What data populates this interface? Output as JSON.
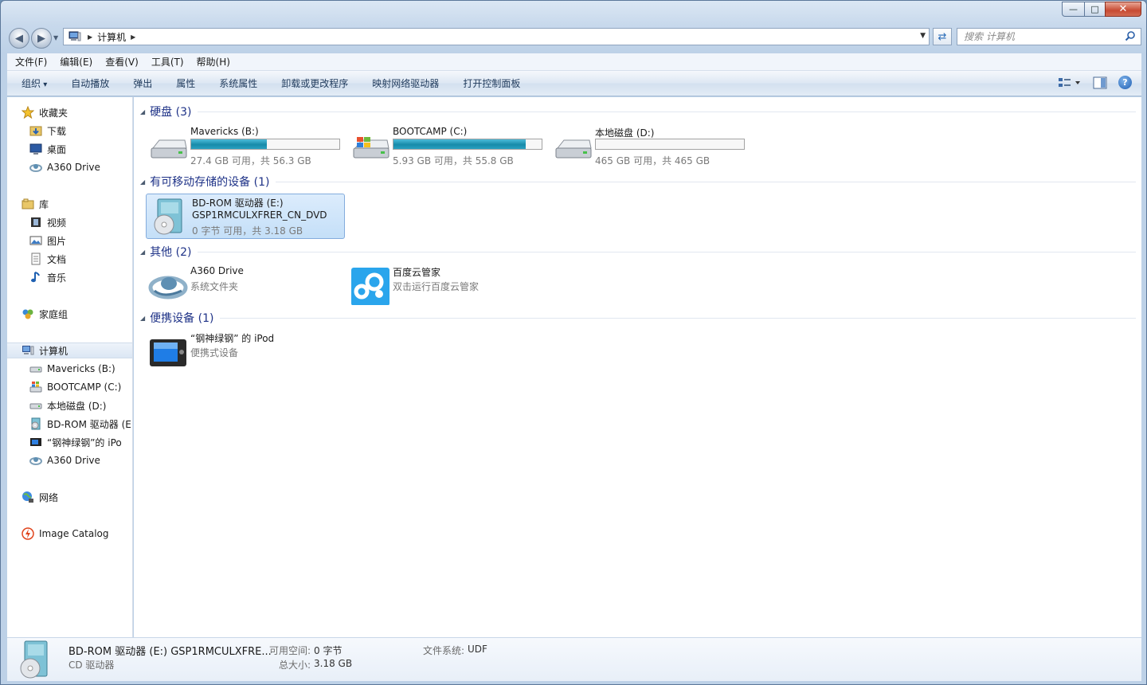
{
  "window": {
    "caption_min": "—",
    "caption_max": "□",
    "caption_close": "✕"
  },
  "address": {
    "crumb": "计算机",
    "search_placeholder": "搜索 计算机"
  },
  "menu": [
    "文件(F)",
    "编辑(E)",
    "查看(V)",
    "工具(T)",
    "帮助(H)"
  ],
  "commands": [
    "组织",
    "自动播放",
    "弹出",
    "属性",
    "系统属性",
    "卸载或更改程序",
    "映射网络驱动器",
    "打开控制面板"
  ],
  "nav": {
    "favorites": "收藏夹",
    "downloads": "下载",
    "desktop": "桌面",
    "a360_fav": "A360 Drive",
    "libraries": "库",
    "videos": "视频",
    "pictures": "图片",
    "documents": "文档",
    "music": "音乐",
    "homegroup": "家庭组",
    "computer": "计算机",
    "mavericks": "Mavericks (B:)",
    "bootcamp": "BOOTCAMP (C:)",
    "local_d": "本地磁盘 (D:)",
    "bdrom": "BD-ROM 驱动器 (E",
    "ipod": "“钢神绿钢”的 iPo",
    "a360_comp": "A360 Drive",
    "network": "网络",
    "image_catalog": "Image Catalog"
  },
  "groups": {
    "hdd": "硬盘 (3)",
    "removable": "有可移动存储的设备 (1)",
    "other": "其他 (2)",
    "portable": "便携设备 (1)"
  },
  "drives": [
    {
      "name": "Mavericks (B:)",
      "info": "27.4 GB 可用，共 56.3 GB",
      "used_fraction": 0.51
    },
    {
      "name": "BOOTCAMP (C:)",
      "info": "5.93 GB 可用，共 55.8 GB",
      "used_fraction": 0.89
    },
    {
      "name": "本地磁盘 (D:)",
      "info": "465 GB 可用，共 465 GB",
      "used_fraction": 0.0
    }
  ],
  "removable_item": {
    "name": "BD-ROM 驱动器 (E:)",
    "label": "GSP1RMCULXFRER_CN_DVD",
    "info": "0 字节 可用，共 3.18 GB"
  },
  "other_items": [
    {
      "name": "A360 Drive",
      "sub": "系统文件夹"
    },
    {
      "name": "百度云管家",
      "sub": "双击运行百度云管家"
    }
  ],
  "portable_item": {
    "name": "“钢神绿钢” 的 iPod",
    "sub": "便携式设备"
  },
  "details": {
    "name": "BD-ROM 驱动器 (E:) GSP1RMCULXFRE...",
    "type": "CD 驱动器",
    "free_label": "可用空间:",
    "free_value": "0 字节",
    "total_label": "总大小:",
    "total_value": "3.18 GB",
    "fs_label": "文件系统:",
    "fs_value": "UDF"
  },
  "icons": {
    "drive": "hard-drive-icon",
    "windows_drive": "windows-drive-icon",
    "optical": "dvd-drive-icon",
    "a360": "a360-drive-icon",
    "baidu": "baidu-cloud-icon",
    "ipod": "portable-device-icon"
  },
  "colors": {
    "bar_fill": "#1e94b5",
    "group_title": "#1e3287",
    "selection": "#c4dff8"
  }
}
